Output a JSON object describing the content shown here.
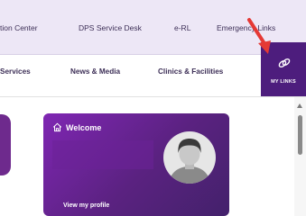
{
  "top_links": [
    "tion Center",
    "DPS Service Desk",
    "e-RL",
    "Emergency Links"
  ],
  "nav_links": [
    "Services",
    "News & Media",
    "Clinics & Facilities"
  ],
  "my_links": {
    "label": "MY LINKS",
    "icon": "link-icon"
  },
  "welcome_card": {
    "title": "Welcome",
    "icon": "home-icon",
    "link": "View my profile",
    "avatar": "avatar"
  },
  "colors": {
    "accent": "#4d1d7d",
    "card": "#6a23a0",
    "topbar": "#ede7f6",
    "annotation_arrow": "#e53935"
  }
}
